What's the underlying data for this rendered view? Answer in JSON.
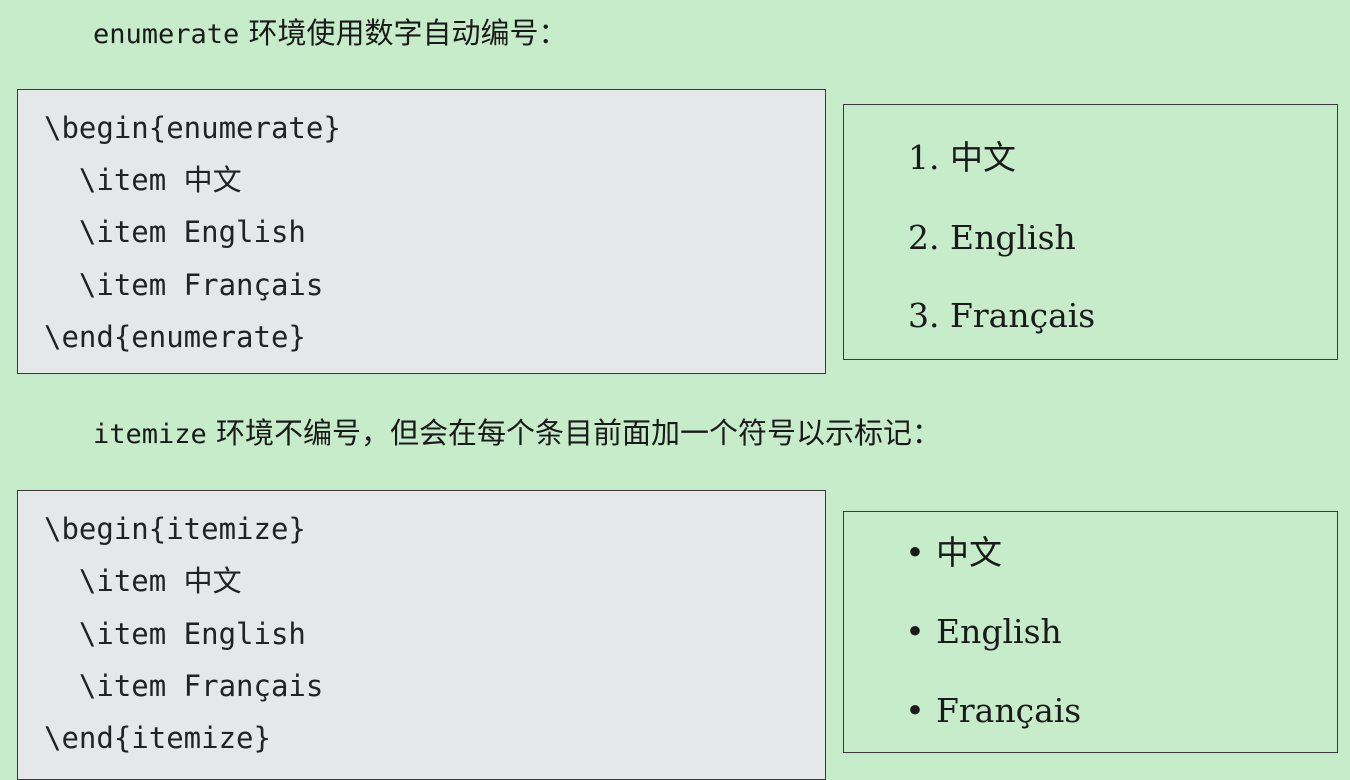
{
  "intro_enumerate": {
    "keyword": "enumerate",
    "text": " 环境使用数字自动编号："
  },
  "enumerate_code": {
    "lines": [
      "\\begin{enumerate}",
      "  \\item 中文",
      "  \\item English",
      "  \\item Français",
      "\\end{enumerate}"
    ]
  },
  "enumerate_output": {
    "items": [
      {
        "marker": "1.",
        "text": "中文"
      },
      {
        "marker": "2.",
        "text": "English"
      },
      {
        "marker": "3.",
        "text": "Français"
      }
    ]
  },
  "intro_itemize": {
    "keyword": "itemize",
    "text": " 环境不编号，但会在每个条目前面加一个符号以示标记："
  },
  "itemize_code": {
    "lines": [
      "\\begin{itemize}",
      "  \\item 中文",
      "  \\item English",
      "  \\item Français",
      "\\end{itemize}"
    ]
  },
  "itemize_output": {
    "items": [
      {
        "marker": "•",
        "text": "中文"
      },
      {
        "marker": "•",
        "text": "English"
      },
      {
        "marker": "•",
        "text": "Français"
      }
    ]
  }
}
